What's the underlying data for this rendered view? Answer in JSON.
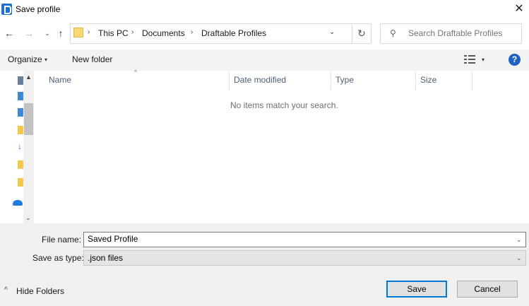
{
  "window": {
    "title": "Save profile",
    "close_glyph": "✕",
    "app_icon": "app-logo-icon"
  },
  "nav": {
    "back_glyph": "←",
    "forward_glyph": "→",
    "recent_glyph": "⌄",
    "up_glyph": "↑",
    "refresh_glyph": "↻",
    "dropdown_glyph": "⌄",
    "breadcrumb": [
      {
        "label": "This PC"
      },
      {
        "label": "Documents"
      },
      {
        "label": "Draftable Profiles"
      }
    ],
    "separator": "›"
  },
  "search": {
    "placeholder": "Search Draftable Profiles",
    "icon": "search-icon"
  },
  "toolbar": {
    "organize_label": "Organize",
    "new_folder_label": "New folder",
    "help_glyph": "?",
    "caret": "▾"
  },
  "file_list": {
    "columns": [
      {
        "label": "Name"
      },
      {
        "label": "Date modified"
      },
      {
        "label": "Type"
      },
      {
        "label": "Size"
      }
    ],
    "sort_indicator": "^",
    "empty_message": "No items match your search."
  },
  "footer": {
    "file_name_label": "File name:",
    "file_name_value": "Saved Profile",
    "save_as_type_label": "Save as type:",
    "save_as_type_value": ".json files",
    "hide_folders_label": "Hide Folders",
    "hide_caret": "^",
    "dropdown_glyph": "⌄",
    "save_label": "Save",
    "cancel_label": "Cancel"
  },
  "colors": {
    "accent": "#0078d7",
    "help": "#1e63c4",
    "folder": "#f8d775"
  }
}
